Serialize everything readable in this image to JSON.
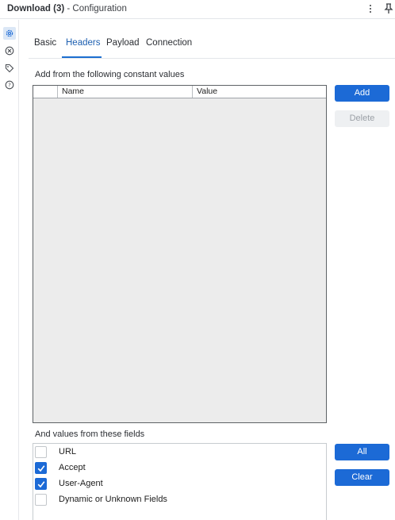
{
  "window": {
    "title_bold": "Download (3)",
    "title_rest": "- Configuration"
  },
  "rail": {
    "icons": [
      "gear-icon",
      "tool-icon",
      "tag-icon",
      "help-icon"
    ]
  },
  "tabs": [
    {
      "label": "Basic",
      "active": false
    },
    {
      "label": "Headers",
      "active": true
    },
    {
      "label": "Payload",
      "active": false
    },
    {
      "label": "Connection",
      "active": false
    }
  ],
  "headers": {
    "constants_label": "Add from the following constant values",
    "columns": [
      "Name",
      "Value"
    ],
    "rows": [],
    "add_label": "Add",
    "delete_label": "Delete",
    "fields_label": "And values from these fields",
    "fields": [
      {
        "label": "URL",
        "checked": false
      },
      {
        "label": "Accept",
        "checked": true
      },
      {
        "label": "User-Agent",
        "checked": true
      },
      {
        "label": "Dynamic or Unknown Fields",
        "checked": false
      }
    ],
    "all_label": "All",
    "clear_label": "Clear"
  },
  "colors": {
    "accent": "#1c6ad6",
    "active_tab_text": "#1d5fb0",
    "grid_background": "#ececec"
  }
}
